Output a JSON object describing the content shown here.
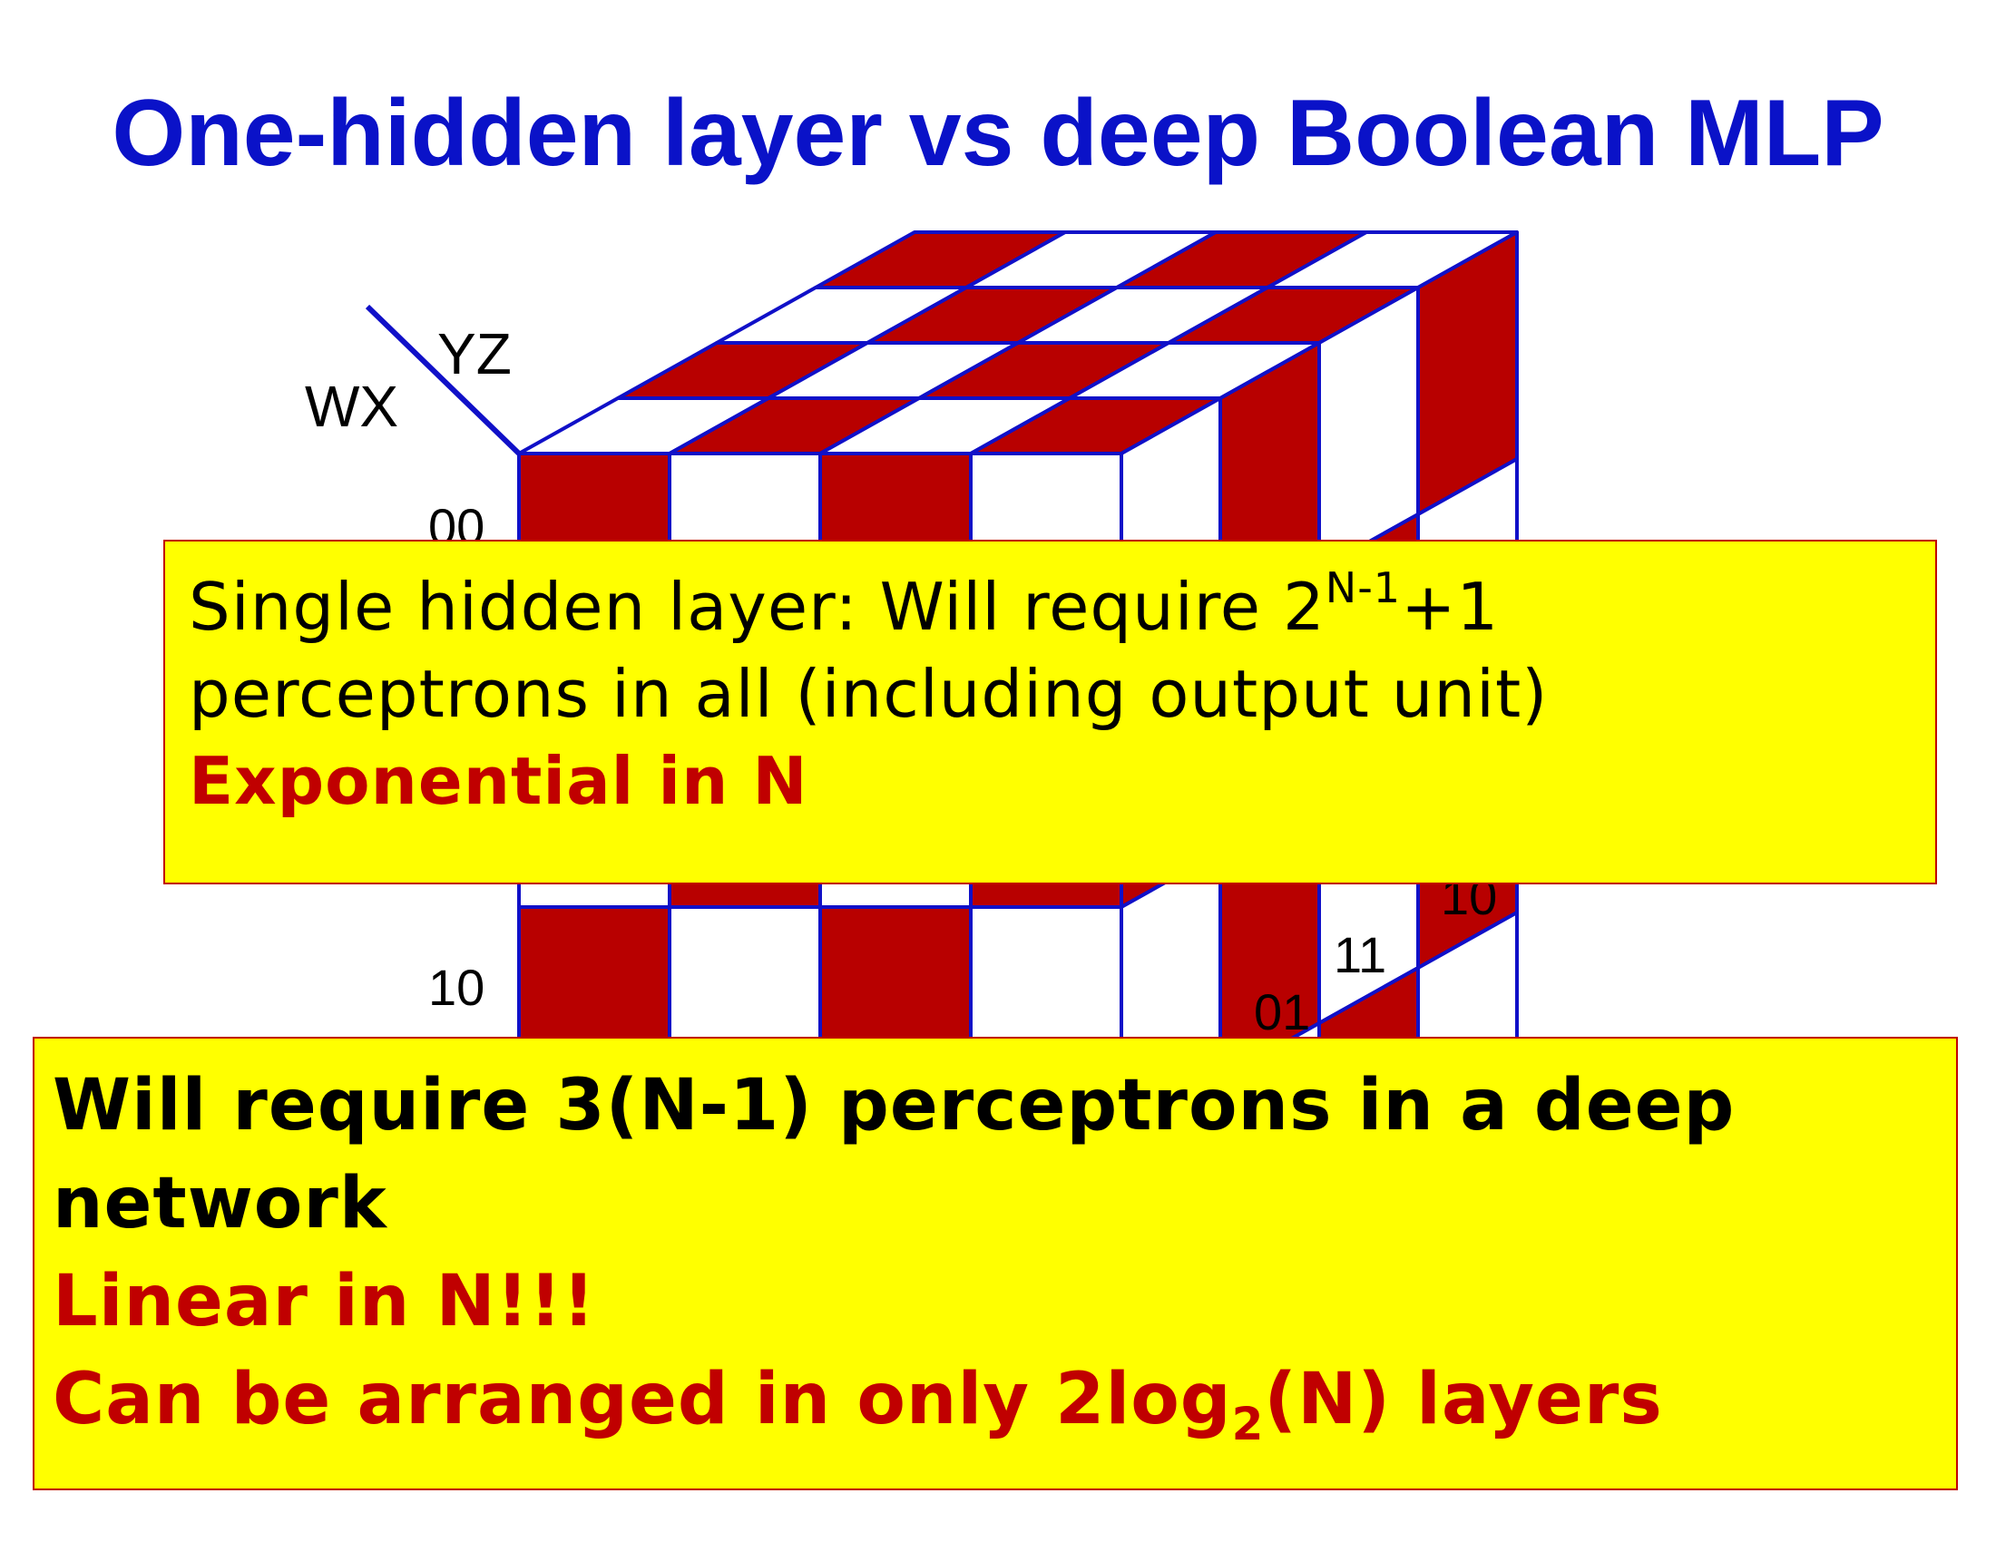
{
  "slide": {
    "title": "One-hidden layer vs deep Boolean MLP",
    "colors": {
      "title": "#0a12c8",
      "cube_red": "#b80000",
      "cube_white": "#ffffff",
      "cube_edge": "#1010c8",
      "box_fill": "#ffff00",
      "box_border": "#c00000",
      "emphasis": "#c00000"
    }
  },
  "kmap": {
    "axis_labels": {
      "row_vars": "WX",
      "col_vars": "YZ"
    },
    "row_labels": [
      "00",
      "10"
    ],
    "depth_labels": [
      "10",
      "11",
      "01"
    ]
  },
  "box1": {
    "line1_main": "Single hidden layer: Will require 2",
    "line1_sup": "N-1",
    "line1_tail": "+1",
    "line2": "perceptrons in all (including output unit)",
    "line3": "Exponential in N"
  },
  "box2": {
    "line1": "Will require 3(N-1) perceptrons in a deep",
    "line2": "network",
    "line3": "Linear in N!!!",
    "line4_main": "Can be arranged in only 2log",
    "line4_sub": "2",
    "line4_tail": "(N) layers"
  }
}
